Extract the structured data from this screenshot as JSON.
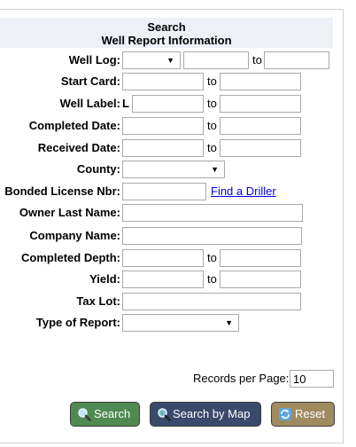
{
  "heading": {
    "line1": "Search",
    "line2": "Well Report Information"
  },
  "fields": {
    "well_log": {
      "label": "Well Log:",
      "to": "to"
    },
    "start_card": {
      "label": "Start Card:",
      "to": "to"
    },
    "well_label": {
      "label": "Well Label:",
      "prefix": "L",
      "to": "to"
    },
    "completed_date": {
      "label": "Completed Date:",
      "to": "to"
    },
    "received_date": {
      "label": "Received Date:",
      "to": "to"
    },
    "county": {
      "label": "County:"
    },
    "bonded_license": {
      "label": "Bonded License Nbr:",
      "link": "Find a Driller"
    },
    "owner_last_name": {
      "label": "Owner Last Name:"
    },
    "company_name": {
      "label": "Company Name:"
    },
    "completed_depth": {
      "label": "Completed Depth:",
      "to": "to"
    },
    "yield": {
      "label": "Yield:",
      "to": "to"
    },
    "tax_lot": {
      "label": "Tax Lot:"
    },
    "type_of_report": {
      "label": "Type of Report:"
    }
  },
  "records_per_page": {
    "label": "Records per Page:",
    "value": "10"
  },
  "buttons": {
    "search": "Search",
    "search_by_map": "Search by Map",
    "reset": "Reset"
  },
  "colors": {
    "search_bg": "#4f8a52",
    "map_bg": "#3a4a6a",
    "reset_bg": "#a08a60",
    "heading_bg": "#eef0f7",
    "link": "#0000ee"
  },
  "icons": {
    "search": "magnifier-icon",
    "map": "magnifier-globe-icon",
    "reset": "refresh-icon"
  }
}
